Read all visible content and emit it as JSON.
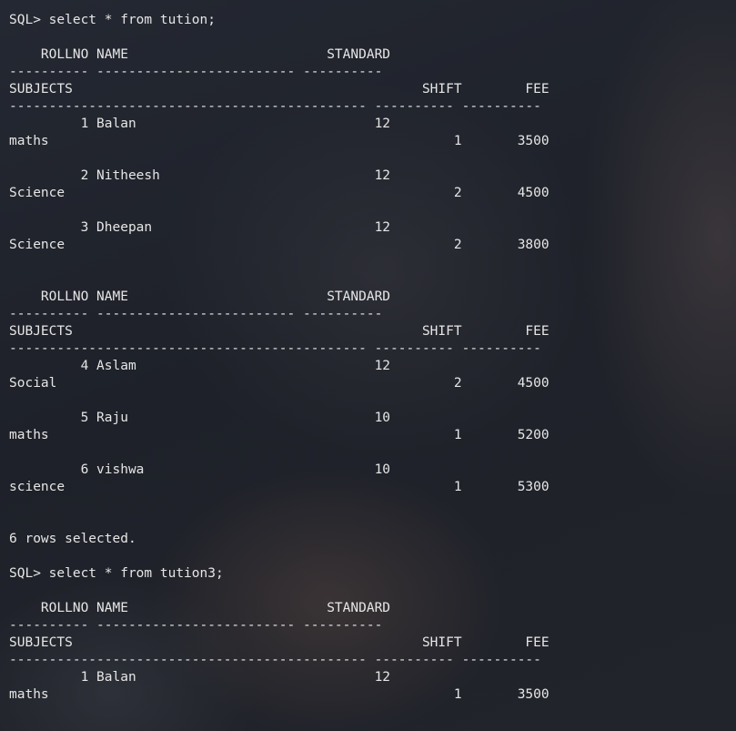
{
  "terminal": {
    "lines": [
      "SQL> select * from tution;",
      "",
      "    ROLLNO NAME                         STANDARD",
      "---------- ------------------------- ----------",
      "SUBJECTS                                            SHIFT        FEE",
      "--------------------------------------------- ---------- ----------",
      "         1 Balan                              12",
      "maths                                                   1       3500",
      "",
      "         2 Nitheesh                           12",
      "Science                                                 2       4500",
      "",
      "         3 Dheepan                            12",
      "Science                                                 2       3800",
      "",
      "",
      "    ROLLNO NAME                         STANDARD",
      "---------- ------------------------- ----------",
      "SUBJECTS                                            SHIFT        FEE",
      "--------------------------------------------- ---------- ----------",
      "         4 Aslam                              12",
      "Social                                                  2       4500",
      "",
      "         5 Raju                               10",
      "maths                                                   1       5200",
      "",
      "         6 vishwa                             10",
      "science                                                 1       5300",
      "",
      "",
      "6 rows selected.",
      "",
      "SQL> select * from tution3;",
      "",
      "    ROLLNO NAME                         STANDARD",
      "---------- ------------------------- ----------",
      "SUBJECTS                                            SHIFT        FEE",
      "--------------------------------------------- ---------- ----------",
      "         1 Balan                              12",
      "maths                                                   1       3500"
    ]
  }
}
